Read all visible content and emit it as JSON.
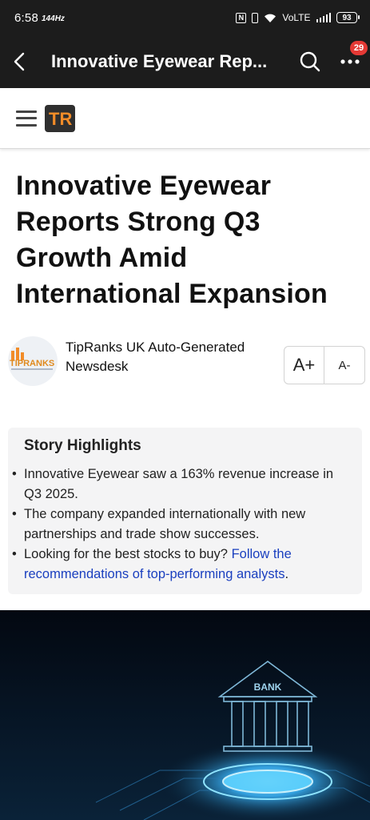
{
  "status_bar": {
    "time": "6:58",
    "refresh_rate": "144",
    "refresh_unit": "Hz",
    "network": "VoLTE",
    "battery": "93"
  },
  "app_bar": {
    "title": "Innovative Eyewear Rep...",
    "notification_count": "29"
  },
  "site": {
    "logo_text": "TR"
  },
  "article": {
    "headline": "Innovative Eyewear Reports Strong Q3 Growth Amid International Expansion",
    "author": "TipRanks UK Auto-Generated Newsdesk",
    "author_logo_text": "TIPRANKS",
    "font_increase_label": "A+",
    "font_decrease_label": "A-"
  },
  "highlights": {
    "title": "Story Highlights",
    "items": [
      {
        "text": "Innovative Eyewear saw a 163% revenue increase in Q3 2025."
      },
      {
        "text": "The company expanded internationally with new partnerships and trade show successes."
      },
      {
        "text_before_link": "Looking for the best stocks to buy? ",
        "link_text": "Follow the recommendations of top-performing analysts",
        "text_after_link": "."
      }
    ]
  },
  "hero_image": {
    "label": "BANK"
  },
  "colors": {
    "app_bar_bg": "#1c1c1c",
    "link": "#1a3fbf",
    "badge": "#e53935",
    "logo_orange": "#f28c28"
  }
}
